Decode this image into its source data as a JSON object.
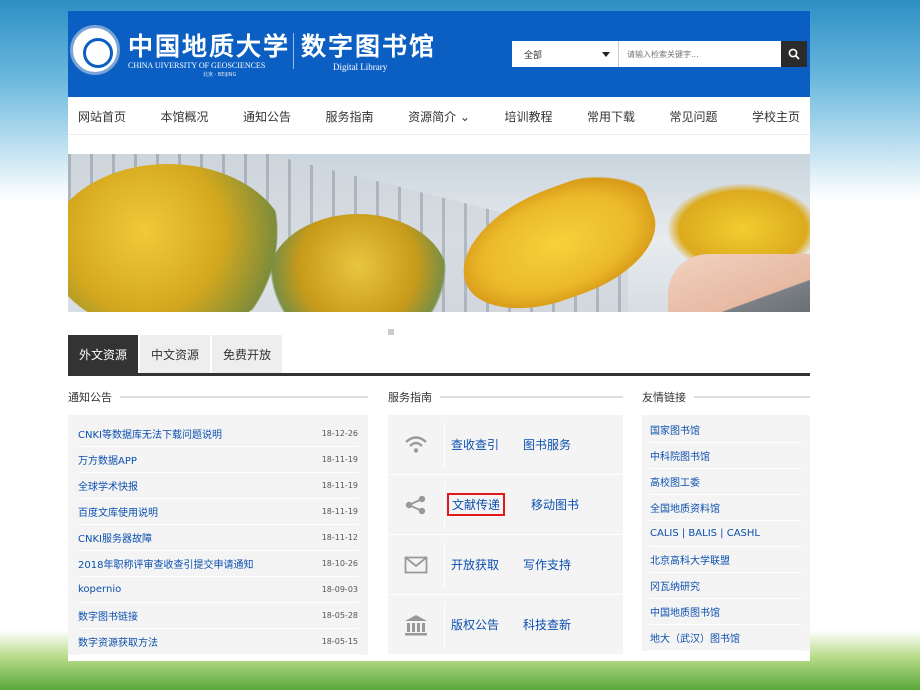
{
  "header": {
    "logo_cn": "中国地质大学",
    "logo_en": "CHINA UIVERSITY OF GEOSCIENCES",
    "logo_city": "北京 · BEIJING",
    "library_cn": "数字图书馆",
    "library_en": "Digital Library",
    "search_scope": "全部",
    "search_placeholder": "请输入检索关键字..."
  },
  "nav": [
    "网站首页",
    "本馆概况",
    "通知公告",
    "服务指南",
    "资源简介 ⌄",
    "培训教程",
    "常用下载",
    "常见问题",
    "学校主页"
  ],
  "tabs": [
    "外文资源",
    "中文资源",
    "免费开放"
  ],
  "notices": {
    "title": "通知公告",
    "items": [
      {
        "title": "CNKI等数据库无法下载问题说明",
        "date": "18-12-26"
      },
      {
        "title": "万方数据APP",
        "date": "18-11-19"
      },
      {
        "title": "全球学术快报",
        "date": "18-11-19"
      },
      {
        "title": "百度文库使用说明",
        "date": "18-11-19"
      },
      {
        "title": "CNKI服务器故障",
        "date": "18-11-12"
      },
      {
        "title": "2018年职称评审查收查引提交申请通知",
        "date": "18-10-26"
      },
      {
        "title": "kopernio",
        "date": "18-09-03"
      },
      {
        "title": "数字图书链接",
        "date": "18-05-28"
      },
      {
        "title": "数字资源获取方法",
        "date": "18-05-15"
      }
    ]
  },
  "services": {
    "title": "服务指南",
    "rows": [
      {
        "icon": "wifi-icon",
        "left": "查收查引",
        "right": "图书服务"
      },
      {
        "icon": "share-icon",
        "left": "文献传递",
        "right": "移动图书"
      },
      {
        "icon": "mail-icon",
        "left": "开放获取",
        "right": "写作支持"
      },
      {
        "icon": "bank-icon",
        "left": "版权公告",
        "right": "科技查新"
      }
    ]
  },
  "links": {
    "title": "友情链接",
    "items": [
      "国家图书馆",
      "中科院图书馆",
      "高校图工委",
      "全国地质资料馆",
      "CALIS | BALIS | CASHL",
      "北京高科大学联盟",
      "冈瓦纳研究",
      "中国地质图书馆",
      "地大（武汉）图书馆"
    ]
  }
}
